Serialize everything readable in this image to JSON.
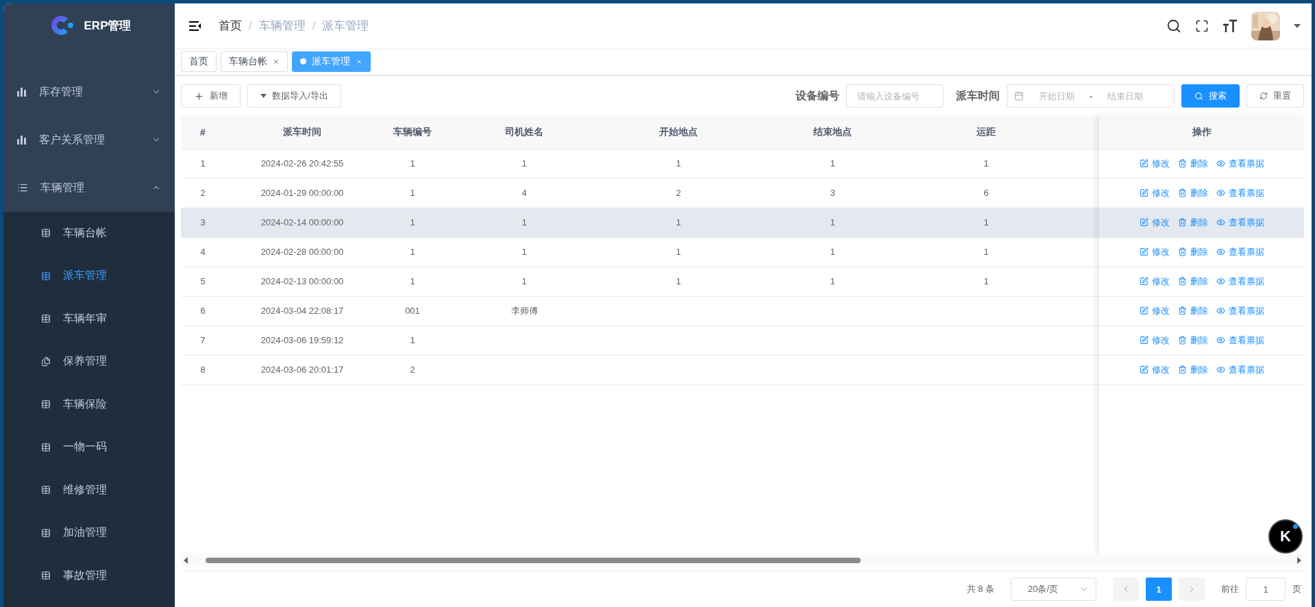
{
  "sidebar": {
    "title": "ERP管理",
    "menu": [
      {
        "label": "库存管理",
        "kind": "chart",
        "expanded": false
      },
      {
        "label": "客户关系管理",
        "kind": "chart",
        "expanded": false
      },
      {
        "label": "车辆管理",
        "kind": "list",
        "expanded": true,
        "children": [
          {
            "label": "车辆台帐",
            "kind": "table",
            "selected": false
          },
          {
            "label": "派车管理",
            "kind": "table",
            "selected": true
          },
          {
            "label": "车辆年审",
            "kind": "table",
            "selected": false
          },
          {
            "label": "保养管理",
            "kind": "files",
            "selected": false
          },
          {
            "label": "车辆保险",
            "kind": "table",
            "selected": false
          },
          {
            "label": "一物一码",
            "kind": "table",
            "selected": false
          },
          {
            "label": "维修管理",
            "kind": "table",
            "selected": false
          },
          {
            "label": "加油管理",
            "kind": "table",
            "selected": false
          },
          {
            "label": "事故管理",
            "kind": "table",
            "selected": false
          }
        ]
      }
    ]
  },
  "breadcrumb": [
    {
      "label": "首页"
    },
    {
      "separator": "/",
      "label": "车辆管理"
    },
    {
      "separator": "/",
      "label": "派车管理"
    }
  ],
  "tags": [
    {
      "label": "首页",
      "selected": false,
      "closable": false
    },
    {
      "label": "车辆台帐",
      "selected": false,
      "closable": true
    },
    {
      "label": "派车管理",
      "selected": true,
      "closable": true
    }
  ],
  "toolbar": {
    "add_button": "新增",
    "import_export_button": "数据导入/导出",
    "filters": [
      {
        "label": "设备编号",
        "placeholder": "请输入设备编号"
      }
    ],
    "date_filter": {
      "label": "派车时间",
      "start_placeholder": "开始日期",
      "separator": "-",
      "end_placeholder": "结束日期"
    },
    "search_button": "搜索",
    "reset_button": "重置"
  },
  "table": {
    "columns": [
      "#",
      "派车时间",
      "车辆编号",
      "司机姓名",
      "开始地点",
      "结束地点",
      "运距"
    ],
    "action_column": "操作",
    "rows": [
      {
        "highlighted": false,
        "cells": [
          "1",
          "2024-02-26 20:42:55",
          "1",
          "1",
          "1",
          "1",
          "1"
        ],
        "actions": [
          {
            "kind": "edit",
            "label": "修改"
          },
          {
            "kind": "delete",
            "label": "删除"
          },
          {
            "kind": "view",
            "label": "查看票据"
          }
        ]
      },
      {
        "highlighted": false,
        "cells": [
          "2",
          "2024-01-29 00:00:00",
          "1",
          "4",
          "2",
          "3",
          "6"
        ],
        "actions": [
          {
            "kind": "edit",
            "label": "修改"
          },
          {
            "kind": "delete",
            "label": "删除"
          },
          {
            "kind": "view",
            "label": "查看票据"
          }
        ]
      },
      {
        "highlighted": true,
        "cells": [
          "3",
          "2024-02-14 00:00:00",
          "1",
          "1",
          "1",
          "1",
          "1"
        ],
        "actions": [
          {
            "kind": "edit",
            "label": "修改"
          },
          {
            "kind": "delete",
            "label": "删除"
          },
          {
            "kind": "view",
            "label": "查看票据"
          }
        ]
      },
      {
        "highlighted": false,
        "cells": [
          "4",
          "2024-02-28 00:00:00",
          "1",
          "1",
          "1",
          "1",
          "1"
        ],
        "actions": [
          {
            "kind": "edit",
            "label": "修改"
          },
          {
            "kind": "delete",
            "label": "删除"
          },
          {
            "kind": "view",
            "label": "查看票据"
          }
        ]
      },
      {
        "highlighted": false,
        "cells": [
          "5",
          "2024-02-13 00:00:00",
          "1",
          "1",
          "1",
          "1",
          "1"
        ],
        "actions": [
          {
            "kind": "edit",
            "label": "修改"
          },
          {
            "kind": "delete",
            "label": "删除"
          },
          {
            "kind": "view",
            "label": "查看票据"
          }
        ]
      },
      {
        "highlighted": false,
        "cells": [
          "6",
          "2024-03-04 22:08:17",
          "001",
          "李师傅"
        ],
        "actions": [
          {
            "kind": "edit",
            "label": "修改"
          },
          {
            "kind": "delete",
            "label": "删除"
          },
          {
            "kind": "view",
            "label": "查看票据"
          }
        ]
      },
      {
        "highlighted": false,
        "cells": [
          "7",
          "2024-03-06 19:59:12",
          "1"
        ],
        "actions": [
          {
            "kind": "edit",
            "label": "修改"
          },
          {
            "kind": "delete",
            "label": "删除"
          },
          {
            "kind": "view",
            "label": "查看票据"
          }
        ]
      },
      {
        "highlighted": false,
        "cells": [
          "8",
          "2024-03-06 20:01:17",
          "2"
        ],
        "actions": [
          {
            "kind": "edit",
            "label": "修改"
          },
          {
            "kind": "delete",
            "label": "删除"
          },
          {
            "kind": "view",
            "label": "查看票据"
          }
        ]
      }
    ]
  },
  "pagination": {
    "total": "共 8 条",
    "page_size": "20条/页",
    "pages": [
      {
        "label": "1",
        "selected": true
      }
    ],
    "prev_disabled": true,
    "next_disabled": true,
    "goto_label": "前往",
    "goto_value": "1",
    "goto_suffix": "页"
  },
  "floating_button": {
    "label": "K"
  }
}
